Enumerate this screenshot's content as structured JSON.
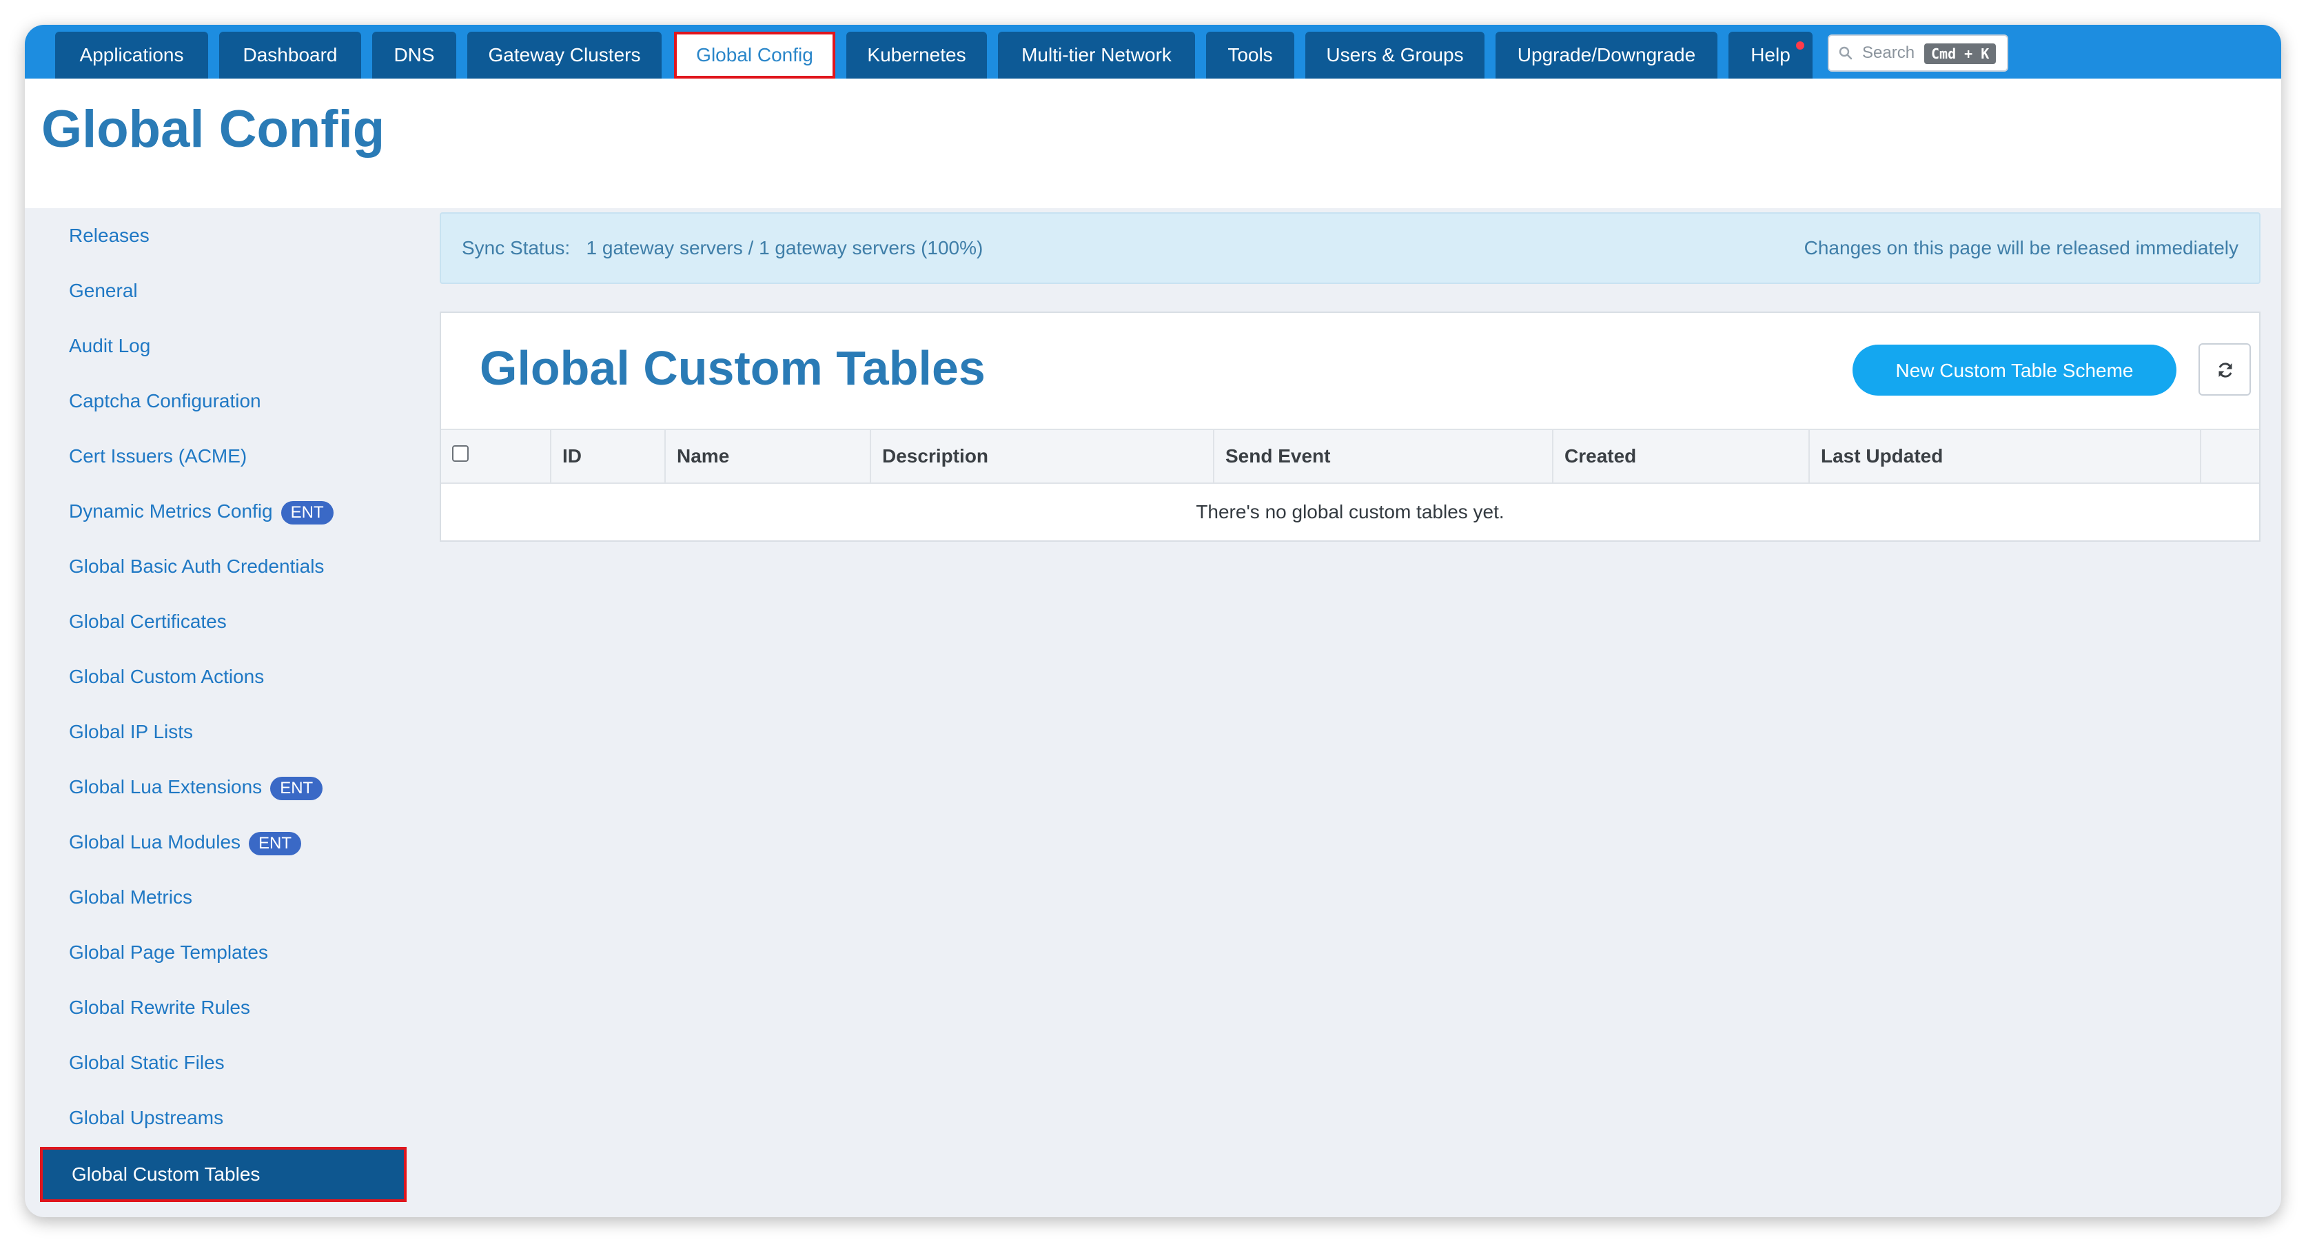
{
  "nav": {
    "tabs": [
      {
        "label": "Applications"
      },
      {
        "label": "Dashboard"
      },
      {
        "label": "DNS"
      },
      {
        "label": "Gateway Clusters"
      },
      {
        "label": "Global Config",
        "active": true
      },
      {
        "label": "Kubernetes"
      },
      {
        "label": "Multi-tier Network"
      },
      {
        "label": "Tools"
      },
      {
        "label": "Users & Groups"
      },
      {
        "label": "Upgrade/Downgrade"
      },
      {
        "label": "Help",
        "notification": true
      }
    ],
    "search": {
      "placeholder": "Search",
      "shortcut": "Cmd + K",
      "icon": "search-icon"
    }
  },
  "header": {
    "title": "Global Config"
  },
  "sidebar": {
    "items": [
      {
        "label": "Releases"
      },
      {
        "label": "General"
      },
      {
        "label": "Audit Log"
      },
      {
        "label": "Captcha Configuration"
      },
      {
        "label": "Cert Issuers (ACME)"
      },
      {
        "label": "Dynamic Metrics Config",
        "badge": "ENT"
      },
      {
        "label": "Global Basic Auth Credentials"
      },
      {
        "label": "Global Certificates"
      },
      {
        "label": "Global Custom Actions"
      },
      {
        "label": "Global IP Lists"
      },
      {
        "label": "Global Lua Extensions",
        "badge": "ENT"
      },
      {
        "label": "Global Lua Modules",
        "badge": "ENT"
      },
      {
        "label": "Global Metrics"
      },
      {
        "label": "Global Page Templates"
      },
      {
        "label": "Global Rewrite Rules"
      },
      {
        "label": "Global Static Files"
      },
      {
        "label": "Global Upstreams"
      },
      {
        "label": "Global Custom Tables",
        "selected": true
      }
    ]
  },
  "sync": {
    "label": "Sync Status:",
    "value": "1 gateway servers / 1 gateway servers (100%)",
    "notice": "Changes on this page will be released immediately"
  },
  "panel": {
    "title": "Global Custom Tables",
    "new_button": "New Custom Table Scheme",
    "refresh_icon": "refresh-icon",
    "columns": [
      "ID",
      "Name",
      "Description",
      "Send Event",
      "Created",
      "Last Updated"
    ],
    "empty_message": "There's no global custom tables yet."
  },
  "colors": {
    "nav_bar": "#1d8de0",
    "nav_tab": "#0d5a96",
    "accent": "#2a7bb6",
    "link": "#1f78c4",
    "selected_item": "#0e5790",
    "highlight_border": "#e0161d",
    "primary_button": "#14a7f0",
    "badge": "#3a69c6"
  }
}
